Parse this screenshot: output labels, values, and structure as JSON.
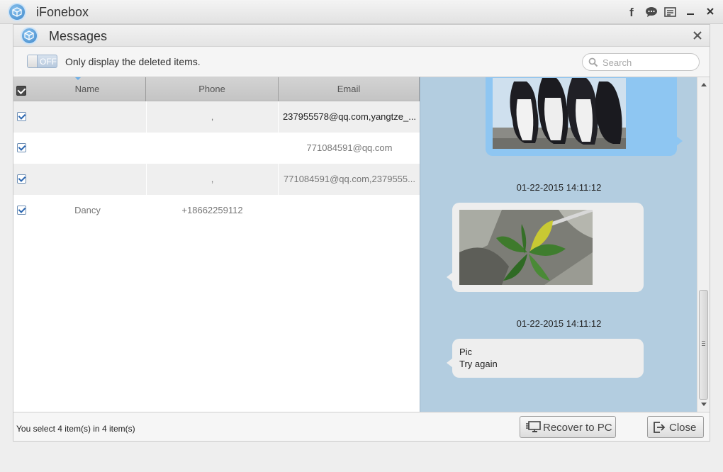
{
  "app": {
    "title": "iFonebox"
  },
  "titlebar_icons": [
    "facebook-icon",
    "chat-icon",
    "feedback-icon",
    "minimize-icon",
    "close-icon"
  ],
  "dialog": {
    "title": "Messages",
    "toggle": {
      "state_label": "OFF",
      "label": "Only display the deleted items."
    },
    "search": {
      "placeholder": "Search",
      "value": ""
    }
  },
  "table": {
    "columns": [
      "Name",
      "Phone",
      "Email"
    ],
    "rows": [
      {
        "checked": true,
        "name": "",
        "phone": ",",
        "email": "237955578@qq.com,yangtze_..."
      },
      {
        "checked": true,
        "name": "",
        "phone": "",
        "email": "771084591@qq.com"
      },
      {
        "checked": true,
        "name": "",
        "phone": ",",
        "email": "771084591@qq.com,2379555..."
      },
      {
        "checked": true,
        "name": "Dancy",
        "phone": "+18662259112",
        "email": ""
      }
    ]
  },
  "messages": [
    {
      "type": "image",
      "direction": "sent",
      "image": "penguins-photo"
    },
    {
      "timestamp": "01-22-2015 14:11:12"
    },
    {
      "type": "image",
      "direction": "received",
      "image": "leaf-photo"
    },
    {
      "timestamp": "01-22-2015 14:11:12"
    },
    {
      "type": "text",
      "direction": "received",
      "lines": [
        "Pic",
        "Try again"
      ]
    }
  ],
  "footer": {
    "status": "You select 4 item(s) in 4 item(s)",
    "recover_label": "Recover to PC",
    "close_label": "Close"
  },
  "colors": {
    "pane_bg": "#b3cde0",
    "sent_bubble": "#8ec6f2",
    "received_bubble": "#eeeeee",
    "accent": "#3d86c8"
  }
}
